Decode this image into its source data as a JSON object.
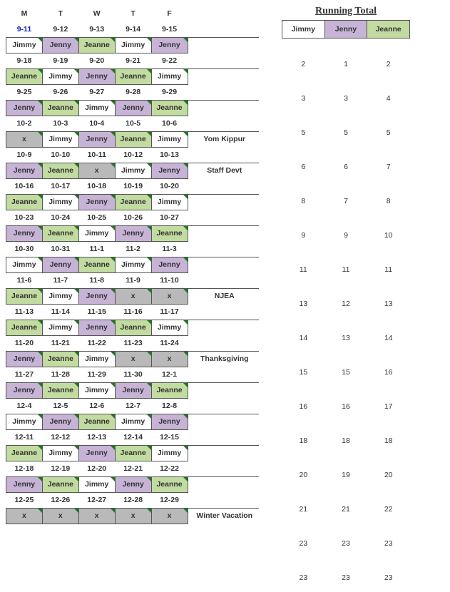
{
  "running_title": "Running Total",
  "days": [
    "M",
    "T",
    "W",
    "T",
    "F"
  ],
  "running_headers": [
    "Jimmy",
    "Jenny",
    "Jeanne"
  ],
  "weeks": [
    {
      "dates": [
        "9-11",
        "9-12",
        "9-13",
        "9-14",
        "9-15"
      ],
      "hl": 0,
      "assign": [
        "Jimmy",
        "Jenny",
        "Jeanne",
        "Jimmy",
        "Jenny"
      ],
      "note": "",
      "run": [
        "2",
        "1",
        "2"
      ]
    },
    {
      "dates": [
        "9-18",
        "9-19",
        "9-20",
        "9-21",
        "9-22"
      ],
      "assign": [
        "Jeanne",
        "Jimmy",
        "Jenny",
        "Jeanne",
        "Jimmy"
      ],
      "note": "",
      "run": [
        "3",
        "3",
        "4"
      ]
    },
    {
      "dates": [
        "9-25",
        "9-26",
        "9-27",
        "9-28",
        "9-29"
      ],
      "assign": [
        "Jenny",
        "Jeanne",
        "Jimmy",
        "Jenny",
        "Jeanne"
      ],
      "note": "",
      "run": [
        "5",
        "5",
        "5"
      ]
    },
    {
      "dates": [
        "10-2",
        "10-3",
        "10-4",
        "10-5",
        "10-6"
      ],
      "assign": [
        "x",
        "Jimmy",
        "Jenny",
        "Jeanne",
        "Jimmy"
      ],
      "note": "Yom Kippur",
      "run": [
        "6",
        "6",
        "7"
      ]
    },
    {
      "dates": [
        "10-9",
        "10-10",
        "10-11",
        "10-12",
        "10-13"
      ],
      "assign": [
        "Jenny",
        "Jeanne",
        "x",
        "Jimmy",
        "Jenny"
      ],
      "note": "Staff Devt",
      "run": [
        "8",
        "7",
        "8"
      ]
    },
    {
      "dates": [
        "10-16",
        "10-17",
        "10-18",
        "10-19",
        "10-20"
      ],
      "assign": [
        "Jeanne",
        "Jimmy",
        "Jenny",
        "Jeanne",
        "Jimmy"
      ],
      "note": "",
      "run": [
        "9",
        "9",
        "10"
      ]
    },
    {
      "dates": [
        "10-23",
        "10-24",
        "10-25",
        "10-26",
        "10-27"
      ],
      "assign": [
        "Jenny",
        "Jeanne",
        "Jimmy",
        "Jenny",
        "Jeanne"
      ],
      "note": "",
      "run": [
        "11",
        "11",
        "11"
      ]
    },
    {
      "dates": [
        "10-30",
        "10-31",
        "11-1",
        "11-2",
        "11-3"
      ],
      "assign": [
        "Jimmy",
        "Jenny",
        "Jeanne",
        "Jimmy",
        "Jenny"
      ],
      "note": "",
      "run": [
        "13",
        "12",
        "13"
      ]
    },
    {
      "dates": [
        "11-6",
        "11-7",
        "11-8",
        "11-9",
        "11-10"
      ],
      "assign": [
        "Jeanne",
        "Jimmy",
        "Jenny",
        "x",
        "x"
      ],
      "note": "NJEA",
      "run": [
        "14",
        "13",
        "14"
      ]
    },
    {
      "dates": [
        "11-13",
        "11-14",
        "11-15",
        "11-16",
        "11-17"
      ],
      "assign": [
        "Jeanne",
        "Jimmy",
        "Jenny",
        "Jeanne",
        "Jimmy"
      ],
      "note": "",
      "run": [
        "15",
        "15",
        "16"
      ]
    },
    {
      "dates": [
        "11-20",
        "11-21",
        "11-22",
        "11-23",
        "11-24"
      ],
      "assign": [
        "Jenny",
        "Jeanne",
        "Jimmy",
        "x",
        "x"
      ],
      "note": "Thanksgiving",
      "run": [
        "16",
        "16",
        "17"
      ]
    },
    {
      "dates": [
        "11-27",
        "11-28",
        "11-29",
        "11-30",
        "12-1"
      ],
      "assign": [
        "Jenny",
        "Jeanne",
        "Jimmy",
        "Jenny",
        "Jeanne"
      ],
      "note": "",
      "run": [
        "18",
        "18",
        "18"
      ]
    },
    {
      "dates": [
        "12-4",
        "12-5",
        "12-6",
        "12-7",
        "12-8"
      ],
      "assign": [
        "Jimmy",
        "Jenny",
        "Jeanne",
        "Jimmy",
        "Jenny"
      ],
      "note": "",
      "run": [
        "20",
        "19",
        "20"
      ]
    },
    {
      "dates": [
        "12-11",
        "12-12",
        "12-13",
        "12-14",
        "12-15"
      ],
      "assign": [
        "Jeanne",
        "Jimmy",
        "Jenny",
        "Jeanne",
        "Jimmy"
      ],
      "note": "",
      "run": [
        "21",
        "21",
        "22"
      ]
    },
    {
      "dates": [
        "12-18",
        "12-19",
        "12-20",
        "12-21",
        "12-22"
      ],
      "assign": [
        "Jenny",
        "Jeanne",
        "Jimmy",
        "Jenny",
        "Jeanne"
      ],
      "note": "",
      "run": [
        "23",
        "23",
        "23"
      ]
    },
    {
      "dates": [
        "12-25",
        "12-26",
        "12-27",
        "12-28",
        "12-29"
      ],
      "assign": [
        "x",
        "x",
        "x",
        "x",
        "x"
      ],
      "note": "Winter Vacation",
      "run": [
        "23",
        "23",
        "23"
      ]
    }
  ]
}
